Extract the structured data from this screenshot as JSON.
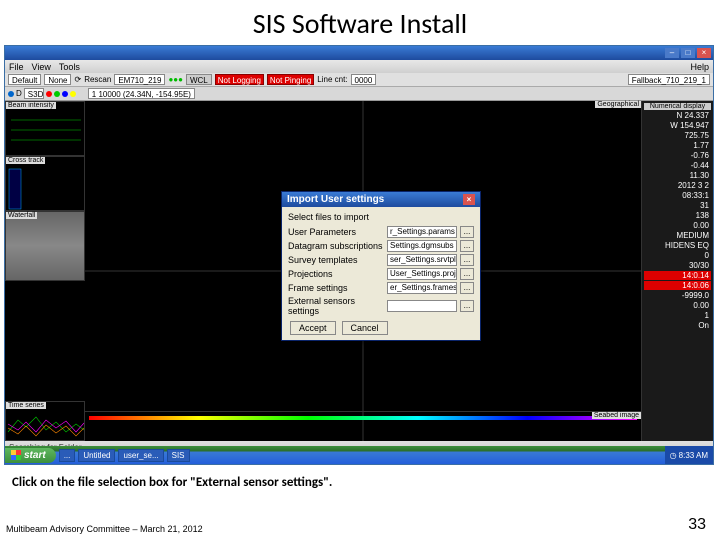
{
  "slide": {
    "title": "SIS Software Install",
    "instruction": "Click on the file selection box for \"External sensor settings\".",
    "footer": "Multibeam Advisory Committee – March 21, 2012",
    "number": "33"
  },
  "menubar": {
    "file": "File",
    "view": "View",
    "tools": "Tools",
    "help": "Help"
  },
  "toolbar1": {
    "preset": "Default",
    "none": "None",
    "rescan": "Rescan",
    "echosounder": "EM710_219",
    "wcl": "WCL",
    "not_logging": "Not Logging",
    "not_pinging": "Not Pinging",
    "line_cnt_lbl": "Line cnt:",
    "line_cnt": "0000",
    "fallback": "Fallback_710_219_1"
  },
  "toolbar2": {
    "coords": "1 10000 (24.34N, -154.95E)"
  },
  "panels": {
    "intensity": "Beam intensity",
    "crosstrack": "Cross track",
    "waterfall": "Waterfall",
    "timeseries": "Time series",
    "geographical": "Geographical",
    "seabed": "Seabed image",
    "numdisplay": "Numerical display"
  },
  "numerical": {
    "lat": "N 24.337",
    "lon": "W 154.947",
    "v1": "725.75",
    "v2": "1.77",
    "v3": "-0.76",
    "v4": "-0.44",
    "v5": "11.30",
    "date": "2012 3 2",
    "time": "08:33:1",
    "v6": "31",
    "v7": "138",
    "v8": "0.00",
    "mode1": "MEDIUM",
    "mode2": "HIDENS EQ",
    "v9": "0",
    "v10": "30/30",
    "red1": "14:0.14",
    "red2": "14:0.06",
    "v11": "-9999.0",
    "v12": "0.00",
    "v13": "1",
    "v14": "On"
  },
  "dialog": {
    "title": "Import User settings",
    "subtitle": "Select files to import",
    "rows": [
      {
        "label": "User Parameters",
        "value": "r_Settings.params"
      },
      {
        "label": "Datagram subscriptions",
        "value": "Settings.dgmsubs"
      },
      {
        "label": "Survey templates",
        "value": "ser_Settings.srvtpl"
      },
      {
        "label": "Projections",
        "value": "User_Settings.proj"
      },
      {
        "label": "Frame settings",
        "value": "er_Settings.frames"
      },
      {
        "label": "External sensors settings",
        "value": ""
      }
    ],
    "accept": "Accept",
    "cancel": "Cancel"
  },
  "statusbar": {
    "text": "Searching for Folder ..."
  },
  "taskbar": {
    "start": "start",
    "items": [
      "...",
      "Untitled",
      "user_se...",
      "SIS"
    ],
    "time": "8:33 AM"
  }
}
